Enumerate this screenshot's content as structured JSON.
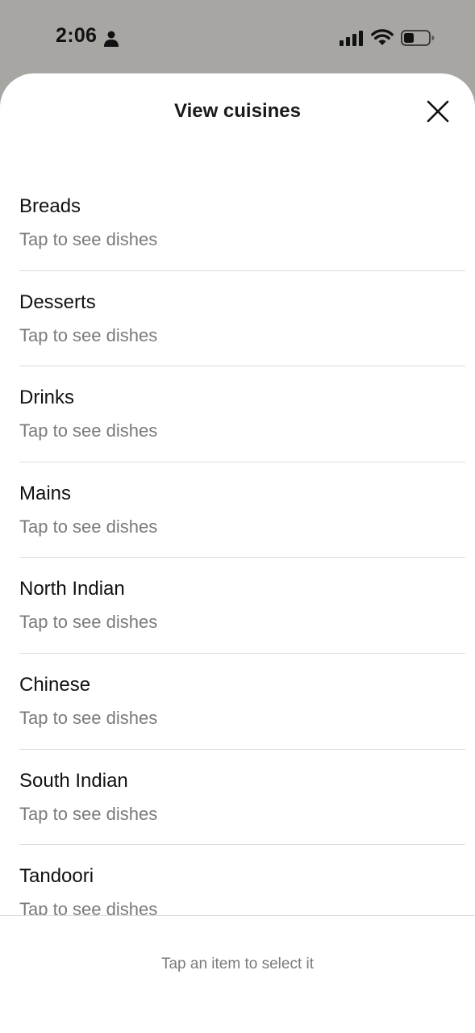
{
  "status_bar": {
    "time": "2:06",
    "icons": [
      "person-icon",
      "signal-icon",
      "wifi-icon",
      "battery-icon"
    ]
  },
  "sheet": {
    "title": "View cuisines",
    "close_icon": "close-icon"
  },
  "cuisines": [
    {
      "title": "Breads",
      "subtitle": "Tap to see dishes"
    },
    {
      "title": "Desserts",
      "subtitle": "Tap to see dishes"
    },
    {
      "title": "Drinks",
      "subtitle": "Tap to see dishes"
    },
    {
      "title": "Mains",
      "subtitle": "Tap to see dishes"
    },
    {
      "title": "North Indian",
      "subtitle": "Tap to see dishes"
    },
    {
      "title": "Chinese",
      "subtitle": "Tap to see dishes"
    },
    {
      "title": "South Indian",
      "subtitle": "Tap to see dishes"
    },
    {
      "title": "Tandoori",
      "subtitle": "Tap to see dishes"
    }
  ],
  "footer": {
    "hint": "Tap an item to select it"
  },
  "colors": {
    "backdrop": "#a8a6a3",
    "sheet": "#ffffff",
    "divider": "#dcdcdc",
    "subtitle": "#7a7a7a"
  }
}
